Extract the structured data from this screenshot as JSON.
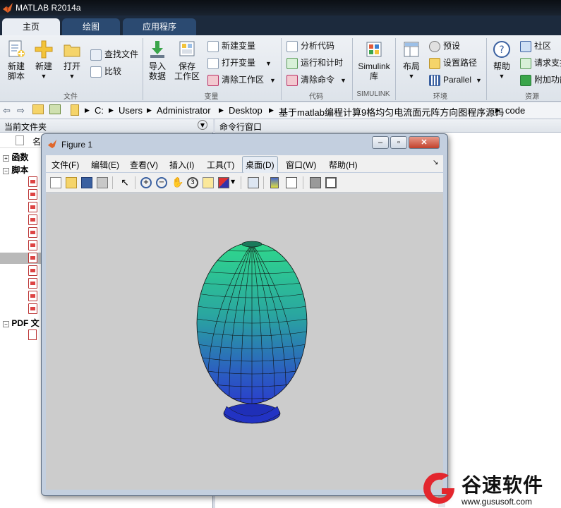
{
  "app_title": "MATLAB R2014a",
  "tabs": [
    "主页",
    "绘图",
    "应用程序"
  ],
  "ribbon": {
    "new_script": [
      "新建",
      "脚本"
    ],
    "new": "新建",
    "open": "打开",
    "find_files": "查找文件",
    "compare": "比较",
    "import_data": [
      "导入",
      "数据"
    ],
    "save_ws": [
      "保存",
      "工作区"
    ],
    "new_var": "新建变量",
    "open_var": "打开变量",
    "clear_ws": "清除工作区",
    "analyze_code": "分析代码",
    "run_time": "运行和计时",
    "clear_cmd": "清除命令",
    "simulink": [
      "Simulink",
      "库"
    ],
    "layout": "布局",
    "prefs": "预设",
    "set_path": "设置路径",
    "parallel": "Parallel",
    "help": "帮助",
    "community": "社区",
    "request_support": "请求支持",
    "addons": "附加功能",
    "groups": {
      "file": "文件",
      "variable": "变量",
      "code": "代码",
      "simulink": "SIMULINK",
      "env": "环境",
      "resources": "资源"
    }
  },
  "address": {
    "parts": [
      "C:",
      "Users",
      "Administrator",
      "Desktop",
      "基于matlab编程计算9格均匀电流面元阵方向图程序源码",
      "code"
    ]
  },
  "left_panel": {
    "title": "当前文件夹",
    "col_name": "名",
    "tree": [
      "函数",
      "脚本",
      "PDF 文"
    ]
  },
  "right_panel": {
    "title": "命令行窗口"
  },
  "figure": {
    "title": "Figure 1",
    "menu": [
      "文件(F)",
      "编辑(E)",
      "查看(V)",
      "插入(I)",
      "工具(T)",
      "桌面(D)",
      "窗口(W)",
      "帮助(H)"
    ]
  },
  "watermark": {
    "brand": "谷速软件",
    "url": "www.gususoft.com"
  },
  "colors": {
    "accent": "#1c2a3d",
    "tab_inactive": "#2b4a71",
    "watermark_red": "#e3262d"
  }
}
